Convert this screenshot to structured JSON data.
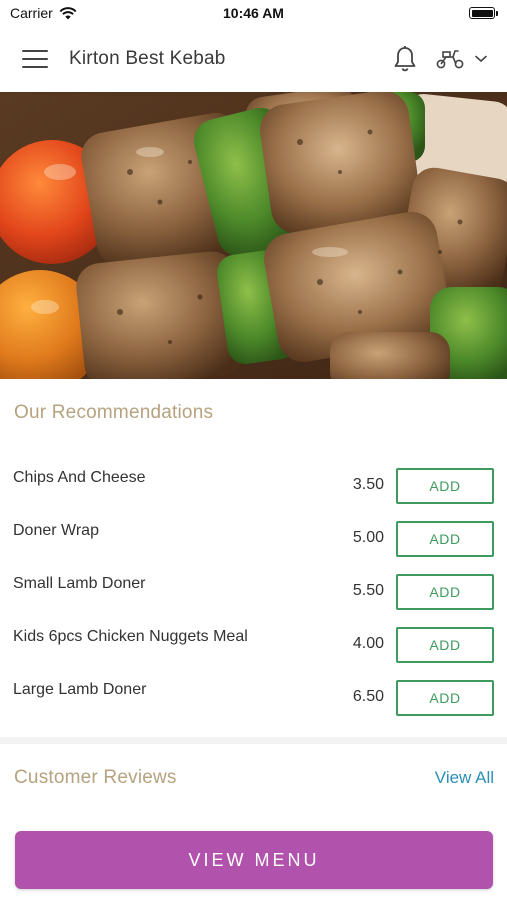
{
  "status_bar": {
    "carrier": "Carrier",
    "time": "10:46 AM"
  },
  "header": {
    "title": "Kirton Best Kebab"
  },
  "recommendations": {
    "title": "Our Recommendations",
    "add_label": "ADD",
    "items": [
      {
        "name": "Chips And Cheese",
        "price": "3.50"
      },
      {
        "name": "Doner Wrap",
        "price": "5.00"
      },
      {
        "name": "Small Lamb Doner",
        "price": "5.50"
      },
      {
        "name": "Kids 6pcs Chicken Nuggets Meal",
        "price": "4.00"
      },
      {
        "name": "Large Lamb Doner",
        "price": "6.50"
      }
    ]
  },
  "reviews": {
    "title": "Customer Reviews",
    "view_all": "View All"
  },
  "cta": {
    "label": "VIEW MENU"
  },
  "colors": {
    "section_title": "#b5a27f",
    "add_button": "#3f9a5d",
    "link": "#2c8fb8",
    "cta_background": "#b152ac"
  },
  "icons": [
    "wifi-icon",
    "battery-icon",
    "menu-icon",
    "bell-icon",
    "scooter-icon",
    "chevron-down-icon"
  ]
}
